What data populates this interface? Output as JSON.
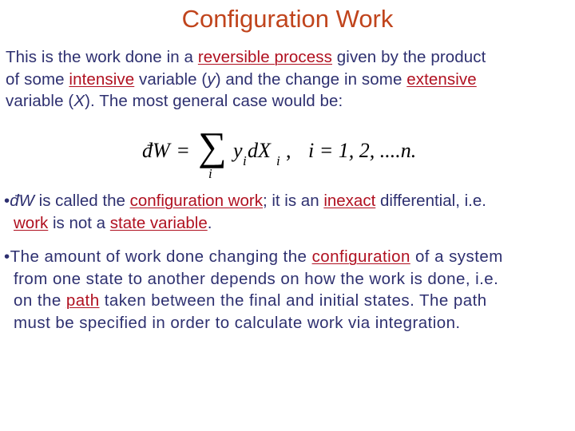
{
  "slide": {
    "title": "Configuration Work",
    "colors": {
      "title": "#c0441c",
      "body_text": "#2e3070",
      "link": "#b01020"
    },
    "intro": {
      "t1": "This is the work done in a ",
      "link1": "reversible process",
      "t2": " given by the product",
      "t3": "of some ",
      "link2": "intensive",
      "t4": " variable (",
      "var_y": "y",
      "t5": ") and the change in some ",
      "link3": "extensive",
      "t6": "variable (",
      "var_x": "X",
      "t7": "). The most general case would be:"
    },
    "equation": {
      "lhs": "đW",
      "equals": "=",
      "sum_symbol": "∑",
      "sum_index": "i",
      "term_y": "y",
      "term_y_sub": "i",
      "term_dx": "dX",
      "term_dx_sub": "i",
      "comma": ",",
      "range": "i = 1, 2, ....n."
    },
    "bullets": [
      {
        "bullet_char": "•",
        "t1": "đW",
        "t2": " is called the ",
        "link1": "configuration work",
        "t3": "; it is an ",
        "link2": "inexact",
        "t4": " differential, i.e.",
        "link3": "work",
        "t5": " is not a ",
        "link4": "state variable",
        "t6": "."
      },
      {
        "bullet_char": "•",
        "t1": "The amount of work done changing the ",
        "link1": "configuration",
        "t2": " of a system",
        "line2": "from one state to another depends on how the work is done, i.e.",
        "t3": "on the ",
        "link2": "path",
        "t4": " taken between the final and initial states. The path",
        "line4": "must be specified in order to calculate work via integration."
      }
    ]
  }
}
